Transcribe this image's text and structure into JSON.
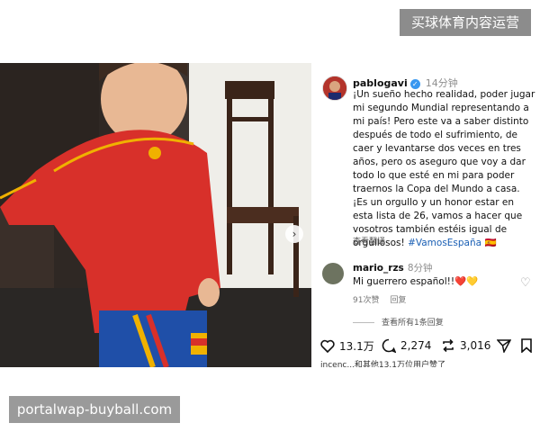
{
  "watermark": {
    "top": "买球体育内容运营",
    "bottom": "portalwap-buyball.com"
  },
  "post": {
    "username": "pablogavi",
    "time": "14分钟",
    "caption": "¡Un sueño hecho realidad, poder jugar mi segundo Mundial representando a mi país! Pero este va a saber distinto después de todo el sufrimiento, de caer y levantarse dos veces en tres años, pero os aseguro que voy a dar todo lo que esté en mi para poder traernos la Copa del Mundo a casa.\n¡Es un orgullo y un honor estar en esta lista de 26, vamos a hacer que vosotros también estéis igual de orgullosos!",
    "hashtag": "#VamosEspaña",
    "flag_emoji": "🇪🇸",
    "see_translation": "查看翻译"
  },
  "comment": {
    "username": "mario_rzs",
    "time": "8分钟",
    "text": "Mi guerrero español!!❤️💛",
    "likes": "91次赞",
    "reply": "回复",
    "view_replies": "查看所有1条回复"
  },
  "actions": {
    "likes": "13.1万",
    "comments": "2,274",
    "shares": "3,016"
  },
  "bottom_strip": "incenc...和其他13.1万位用户赞了",
  "icons": [
    "verified-icon",
    "heart-icon",
    "comment-icon",
    "repost-icon",
    "send-icon",
    "bookmark-icon",
    "carousel-next-icon"
  ]
}
